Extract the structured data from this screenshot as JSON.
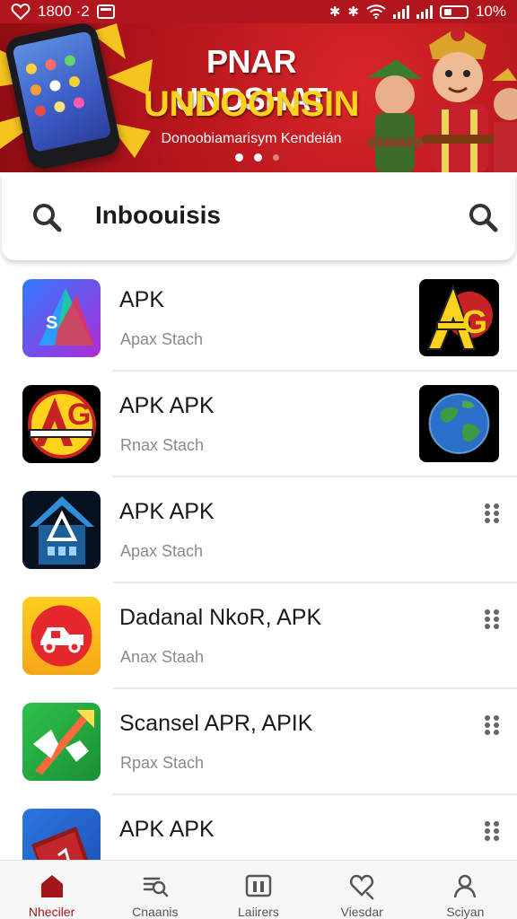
{
  "status_bar": {
    "time": "1800 ·2",
    "battery": "10%",
    "icons": [
      "heart-icon",
      "message-icon",
      "mute-icon",
      "bluetooth-icon",
      "wifi-icon",
      "signal-icon",
      "signal-icon",
      "battery-icon"
    ]
  },
  "banner": {
    "title_line1": "PNAR UNDSHAT",
    "title_line2": "UNDOONSIN",
    "subtitle": "Donoobiamarisym Kendeián",
    "colors": {
      "background": "#b3151b",
      "title2": "#ffd21c"
    },
    "pager": {
      "count": 3,
      "active": 0
    }
  },
  "search": {
    "text": "Inboouisis",
    "left_icon": "search-icon",
    "right_icon": "search-icon"
  },
  "apps": [
    {
      "title": "APK",
      "subtitle": "Apax Stach",
      "icon": "triangle-s-logo",
      "trailing": "thumbnail",
      "trailing_icon": "ag-logo-thumbnail"
    },
    {
      "title": "APK APK",
      "subtitle": "Rnax Stach",
      "icon": "ag-logo",
      "trailing": "thumbnail",
      "trailing_icon": "globe-thumbnail"
    },
    {
      "title": "APK APK",
      "subtitle": "Apax Stach",
      "icon": "house-logo",
      "trailing": "more",
      "trailing_icon": "drag-handle-icon"
    },
    {
      "title": "Dadanal NkoR, APK",
      "subtitle": "Anax Staah",
      "icon": "car-logo",
      "trailing": "more",
      "trailing_icon": "drag-handle-icon"
    },
    {
      "title": "Scansel APR, APIK",
      "subtitle": "Rpax Stach",
      "icon": "arrow-logo",
      "trailing": "more",
      "trailing_icon": "drag-handle-icon"
    },
    {
      "title": "APK APK",
      "subtitle": "",
      "icon": "book-logo",
      "trailing": "more",
      "trailing_icon": "drag-handle-icon"
    }
  ],
  "bottom_nav": {
    "active_color": "#a3171b",
    "items": [
      {
        "label": "Nheciler",
        "icon": "home-icon",
        "active": true
      },
      {
        "label": "Cnaanis",
        "icon": "search-list-icon",
        "active": false
      },
      {
        "label": "Laiirers",
        "icon": "library-icon",
        "active": false
      },
      {
        "label": "Viesdar",
        "icon": "chat-heart-icon",
        "active": false
      },
      {
        "label": "Sciyan",
        "icon": "profile-icon",
        "active": false
      }
    ]
  }
}
